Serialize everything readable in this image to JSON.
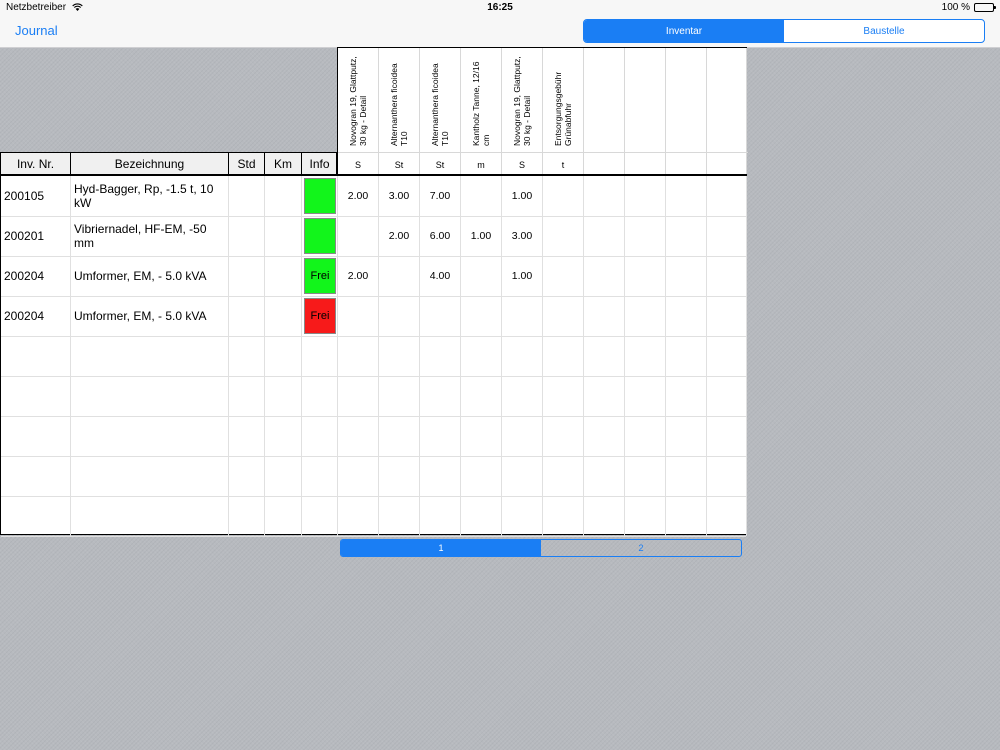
{
  "status": {
    "carrier": "Netzbetreiber",
    "time": "16:25",
    "battery": "100 %",
    "battery_level": 1.0
  },
  "nav": {
    "back_label": "Journal",
    "segments": [
      "Inventar",
      "Baustelle"
    ],
    "active_segment": 0
  },
  "table": {
    "headers": {
      "inv": "Inv. Nr.",
      "bez": "Bezeichnung",
      "std": "Std",
      "km": "Km",
      "info": "Info"
    },
    "material_columns": [
      {
        "name": "Novogran 19, Glattputz, 30 kg - Detail",
        "unit": "S"
      },
      {
        "name": "Alternanthera ficoidea T10",
        "unit": "St"
      },
      {
        "name": "Alternanthera ficoidea T10",
        "unit": "St"
      },
      {
        "name": "Kantholz Tanne, 12/16 cm",
        "unit": "m"
      },
      {
        "name": "Novogran 19, Glattputz, 30 kg - Detail",
        "unit": "S"
      },
      {
        "name": "Entsorgungsgebühr Grünabfuhr",
        "unit": "t"
      },
      {
        "name": "",
        "unit": ""
      },
      {
        "name": "",
        "unit": ""
      },
      {
        "name": "",
        "unit": ""
      },
      {
        "name": "",
        "unit": ""
      }
    ],
    "rows": [
      {
        "inv": "200105",
        "bez": "Hyd-Bagger, Rp, -1.5 t, 10 kW",
        "std": "",
        "km": "",
        "info_label": "",
        "info_color": "#12f51b",
        "values": [
          "2.00",
          "3.00",
          "7.00",
          "",
          "1.00",
          "",
          "",
          "",
          "",
          ""
        ]
      },
      {
        "inv": "200201",
        "bez": "Vibriernadel, HF-EM, -50 mm",
        "std": "",
        "km": "",
        "info_label": "",
        "info_color": "#12f51b",
        "values": [
          "",
          "2.00",
          "6.00",
          "1.00",
          "3.00",
          "",
          "",
          "",
          "",
          ""
        ]
      },
      {
        "inv": "200204",
        "bez": "Umformer, EM, - 5.0 kVA",
        "std": "",
        "km": "",
        "info_label": "Frei",
        "info_color": "#12f51b",
        "values": [
          "2.00",
          "",
          "4.00",
          "",
          "1.00",
          "",
          "",
          "",
          "",
          ""
        ]
      },
      {
        "inv": "200204",
        "bez": "Umformer, EM, - 5.0 kVA",
        "std": "",
        "km": "",
        "info_label": "Frei",
        "info_color": "#f71a1a",
        "values": [
          "",
          "",
          "",
          "",
          "",
          "",
          "",
          "",
          "",
          ""
        ]
      }
    ],
    "empty_rows": 5
  },
  "pager": {
    "pages": [
      "1",
      "2"
    ],
    "active_page": 0
  }
}
